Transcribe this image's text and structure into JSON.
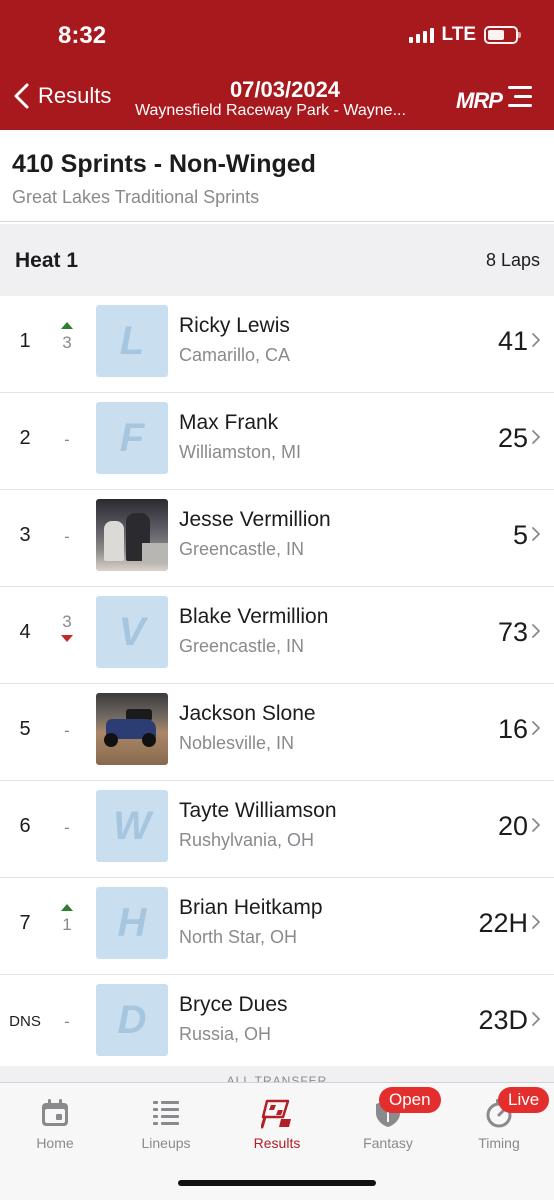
{
  "status_bar": {
    "time": "8:32",
    "network": "LTE"
  },
  "nav": {
    "back_label": "Results",
    "date": "07/03/2024",
    "track": "Waynesfield Raceway Park - Wayne...",
    "logo_text": "MRP"
  },
  "class": {
    "title": "410 Sprints - Non-Winged",
    "subtitle": "Great Lakes Traditional Sprints"
  },
  "heat": {
    "name": "Heat 1",
    "laps": "8 Laps"
  },
  "results": [
    {
      "pos": "1",
      "move": "3",
      "dir": "up",
      "avatar": "L",
      "driver": "Ricky Lewis",
      "hometown": "Camarillo, CA",
      "car": "41"
    },
    {
      "pos": "2",
      "move": "-",
      "dir": "none",
      "avatar": "F",
      "driver": "Max Frank",
      "hometown": "Williamston, MI",
      "car": "25"
    },
    {
      "pos": "3",
      "move": "-",
      "dir": "none",
      "avatar": "photo-people",
      "driver": "Jesse Vermillion",
      "hometown": "Greencastle, IN",
      "car": "5"
    },
    {
      "pos": "4",
      "move": "3",
      "dir": "down",
      "avatar": "V",
      "driver": "Blake Vermillion",
      "hometown": "Greencastle, IN",
      "car": "73"
    },
    {
      "pos": "5",
      "move": "-",
      "dir": "none",
      "avatar": "photo-car",
      "driver": "Jackson Slone",
      "hometown": "Noblesville, IN",
      "car": "16"
    },
    {
      "pos": "6",
      "move": "-",
      "dir": "none",
      "avatar": "W",
      "driver": "Tayte Williamson",
      "hometown": "Rushylvania, OH",
      "car": "20"
    },
    {
      "pos": "7",
      "move": "1",
      "dir": "up",
      "avatar": "H",
      "driver": "Brian Heitkamp",
      "hometown": "North Star, OH",
      "car": "22H"
    },
    {
      "pos": "DNS",
      "move": "-",
      "dir": "none",
      "avatar": "D",
      "driver": "Bryce Dues",
      "hometown": "Russia, OH",
      "car": "23D"
    }
  ],
  "transfer_label": "ALL TRANSFER",
  "tabs": [
    {
      "label": "Home",
      "icon": "calendar-icon"
    },
    {
      "label": "Lineups",
      "icon": "list-icon"
    },
    {
      "label": "Results",
      "icon": "checkered-flag-icon",
      "active": true
    },
    {
      "label": "Fantasy",
      "icon": "shield-icon",
      "badge": "Open"
    },
    {
      "label": "Timing",
      "icon": "stopwatch-icon",
      "badge": "Live"
    }
  ],
  "colors": {
    "header": "#a8191e",
    "accent": "#b21f24",
    "badge": "#e42d2d",
    "up": "#2e7d32",
    "down": "#c62828"
  }
}
